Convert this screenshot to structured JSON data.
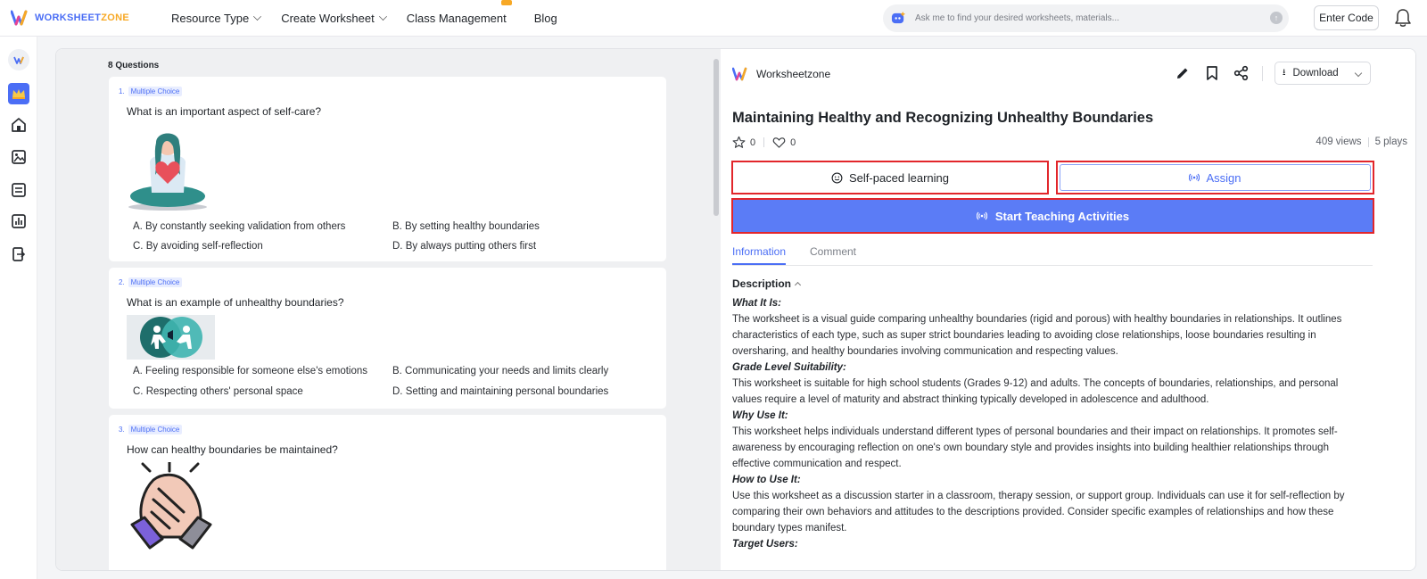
{
  "header": {
    "logo": {
      "prefix": "WORKSHEET",
      "suffix": "ZONE"
    },
    "nav": [
      {
        "label": "Resource Type",
        "dropdown": true
      },
      {
        "label": "Create Worksheet",
        "dropdown": true
      },
      {
        "label": "Class Management",
        "dropdown": false
      },
      {
        "label": "Blog",
        "dropdown": false
      }
    ],
    "search_placeholder": "Ask me to find your desired worksheets, materials...",
    "enter_code": "Enter Code"
  },
  "rail": {
    "icons": [
      "user-avatar-icon",
      "crown-icon",
      "home-icon",
      "image-icon",
      "library-icon",
      "chart-icon",
      "exit-icon"
    ]
  },
  "questions_panel": {
    "count": "8 Questions",
    "questions": [
      {
        "number": "1.",
        "type": "Multiple Choice",
        "text": "What is an important aspect of self-care?",
        "image": "self-care-illustration",
        "options": [
          "A. By constantly seeking validation from others",
          "B. By setting healthy boundaries",
          "C. By avoiding self-reflection",
          "D. By always putting others first"
        ]
      },
      {
        "number": "2.",
        "type": "Multiple Choice",
        "text": "What is an example of unhealthy boundaries?",
        "image": "boundaries-illustration",
        "options": [
          "A. Feeling responsible for someone else's emotions",
          "B. Communicating your needs and limits clearly",
          "C. Respecting others' personal space",
          "D. Setting and maintaining personal boundaries"
        ]
      },
      {
        "number": "3.",
        "type": "Multiple Choice",
        "text": "How can healthy boundaries be maintained?",
        "image": "handshake-illustration",
        "options": []
      }
    ]
  },
  "detail": {
    "publisher": "Worksheetzone",
    "download_label": "Download",
    "title": "Maintaining Healthy and Recognizing Unhealthy Boundaries",
    "stars": "0",
    "likes": "0",
    "views": "409 views",
    "plays": "5 plays",
    "self_paced_label": "Self-paced learning",
    "assign_label": "Assign",
    "start_label": "Start Teaching Activities",
    "tabs": [
      "Information",
      "Comment"
    ],
    "description_label": "Description",
    "description": [
      {
        "heading": "What It Is:",
        "body": "The worksheet is a visual guide comparing unhealthy boundaries (rigid and porous) with healthy boundaries in relationships. It outlines characteristics of each type, such as super strict boundaries leading to avoiding close relationships, loose boundaries resulting in oversharing, and healthy boundaries involving communication and respecting values."
      },
      {
        "heading": "Grade Level Suitability:",
        "body": "This worksheet is suitable for high school students (Grades 9-12) and adults. The concepts of boundaries, relationships, and personal values require a level of maturity and abstract thinking typically developed in adolescence and adulthood."
      },
      {
        "heading": "Why Use It:",
        "body": "This worksheet helps individuals understand different types of personal boundaries and their impact on relationships. It promotes self-awareness by encouraging reflection on one's own boundary style and provides insights into building healthier relationships through effective communication and respect."
      },
      {
        "heading": "How to Use It:",
        "body": "Use this worksheet as a discussion starter in a classroom, therapy session, or support group. Individuals can use it for self-reflection by comparing their own behaviors and attitudes to the descriptions provided. Consider specific examples of relationships and how these boundary types manifest."
      },
      {
        "heading": "Target Users:",
        "body": ""
      }
    ]
  },
  "colors": {
    "accent": "#4b6ef5",
    "primary_button": "#5b7cf6",
    "highlight_border": "#e2262b",
    "logo_orange": "#f7a825"
  }
}
